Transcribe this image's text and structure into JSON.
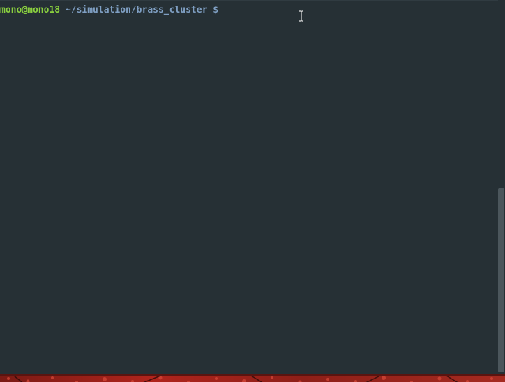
{
  "terminal": {
    "prompt": {
      "user_host": "mono@mono18",
      "path": "~/simulation/brass_cluster",
      "symbol": "$"
    }
  },
  "colors": {
    "background": "#263035",
    "user_host": "#8ad03f",
    "path": "#7f9fc3",
    "scrollbar_thumb": "#4b565c"
  },
  "scrollbar": {
    "position_fraction": 0.5,
    "visible_fraction": 0.49
  }
}
